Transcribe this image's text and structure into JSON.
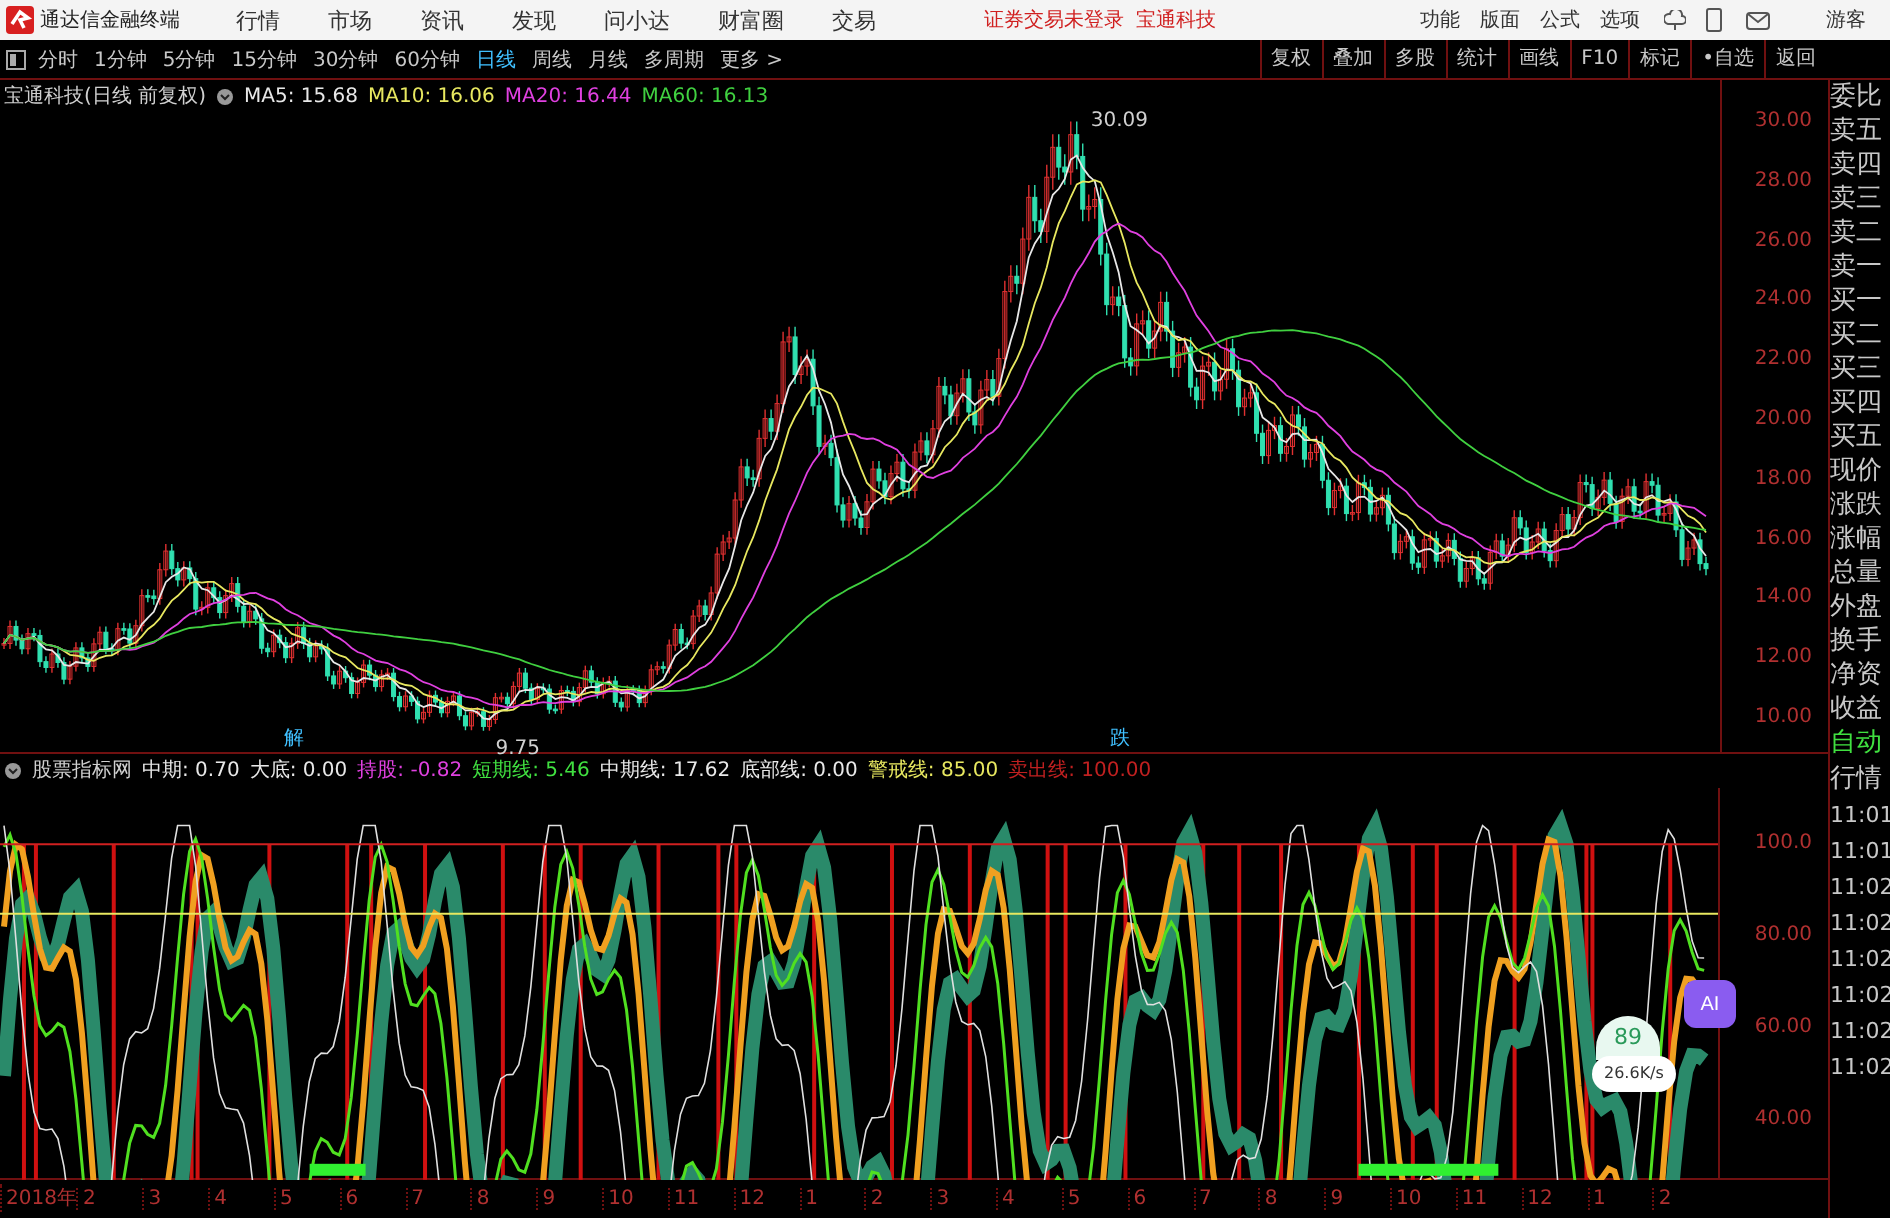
{
  "app": {
    "title": "通达信金融终端",
    "menu": [
      "行情",
      "市场",
      "资讯",
      "发现",
      "问小达",
      "财富圈",
      "交易"
    ],
    "login_status": "证券交易未登录",
    "stock_link": "宝通科技",
    "tools": [
      "功能",
      "版面",
      "公式",
      "选项"
    ],
    "user": "游客"
  },
  "toolbar": {
    "periods": [
      {
        "label": "分时",
        "selected": false
      },
      {
        "label": "1分钟",
        "selected": false
      },
      {
        "label": "5分钟",
        "selected": false
      },
      {
        "label": "15分钟",
        "selected": false
      },
      {
        "label": "30分钟",
        "selected": false
      },
      {
        "label": "60分钟",
        "selected": false
      },
      {
        "label": "日线",
        "selected": true
      },
      {
        "label": "周线",
        "selected": false
      },
      {
        "label": "月线",
        "selected": false
      },
      {
        "label": "多周期",
        "selected": false
      },
      {
        "label": "更多 >",
        "selected": false
      }
    ],
    "actions": [
      "复权",
      "叠加",
      "多股",
      "统计",
      "画线",
      "F10",
      "标记",
      "•自选",
      "返回"
    ]
  },
  "main_chart": {
    "title": "宝通科技(日线 前复权)",
    "ma": [
      {
        "label": "MA5: 15.68",
        "color": "#e8e8e8"
      },
      {
        "label": "MA10: 16.06",
        "color": "#e8e860"
      },
      {
        "label": "MA20: 16.44",
        "color": "#e040e0"
      },
      {
        "label": "MA60: 16.13",
        "color": "#40d040"
      }
    ],
    "high_label": "30.09",
    "low_label": "9.75",
    "markers": [
      "解",
      "跌"
    ],
    "price_axis": [
      "30.00",
      "28.00",
      "26.00",
      "24.00",
      "22.00",
      "20.00",
      "18.00",
      "16.00",
      "14.00",
      "12.00",
      "10.00"
    ]
  },
  "indicator": {
    "name": "股票指标网",
    "values": [
      {
        "label": "中期: 0.70",
        "color": "#e8e8e8"
      },
      {
        "label": "大底: 0.00",
        "color": "#e8e8e8"
      },
      {
        "label": "持股: -0.82",
        "color": "#e040e0"
      },
      {
        "label": "短期线: 5.46",
        "color": "#40e040"
      },
      {
        "label": "中期线: 17.62",
        "color": "#e8e8e8"
      },
      {
        "label": "底部线: 0.00",
        "color": "#e8e8e8"
      },
      {
        "label": "警戒线: 85.00",
        "color": "#e8e860"
      },
      {
        "label": "卖出线: 100.00",
        "color": "#c02020"
      }
    ],
    "axis": [
      "100.0",
      "80.00",
      "60.00",
      "40.00"
    ]
  },
  "time_axis": [
    "2018年",
    "2",
    "3",
    "4",
    "5",
    "6",
    "7",
    "8",
    "9",
    "10",
    "11",
    "12",
    "1",
    "2",
    "3",
    "4",
    "5",
    "6",
    "7",
    "8",
    "9",
    "10",
    "11",
    "12",
    "1",
    "2"
  ],
  "sidebar": {
    "quote_fields": [
      "委比",
      "卖五",
      "卖四",
      "卖三",
      "卖二",
      "卖一",
      "买一",
      "买二",
      "买三",
      "买四",
      "买五",
      "现价",
      "涨跌",
      "涨幅",
      "总量",
      "外盘",
      "换手",
      "净资",
      "收益"
    ],
    "tabs": [
      "自动",
      "行情"
    ],
    "times": [
      "11:01",
      "11:01",
      "11:02",
      "11:02",
      "11:02",
      "11:02",
      "11:02",
      "11:02"
    ]
  },
  "overlay": {
    "ai_button": "AI",
    "speed": "26.6K/s",
    "score": "89"
  }
}
